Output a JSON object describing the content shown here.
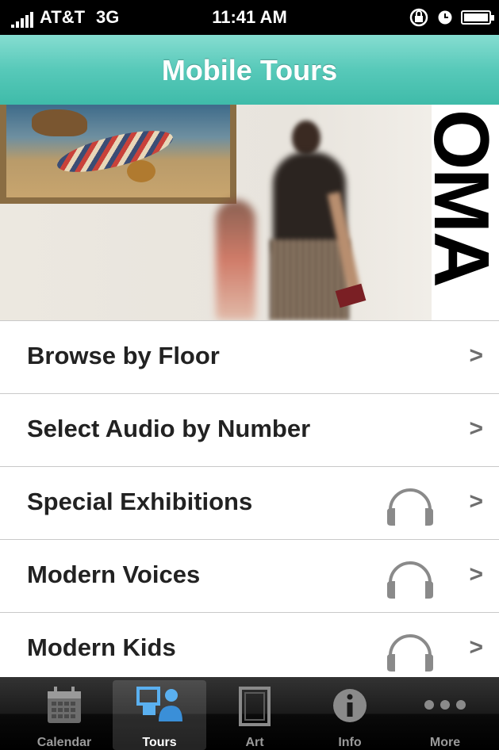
{
  "status_bar": {
    "carrier": "AT&T",
    "network": "3G",
    "time": "11:41 AM"
  },
  "nav": {
    "title": "Mobile Tours"
  },
  "hero": {
    "wall_text": "OMA"
  },
  "menu": [
    {
      "label": "Browse by Floor",
      "audio": false
    },
    {
      "label": "Select Audio by Number",
      "audio": false
    },
    {
      "label": "Special Exhibitions",
      "audio": true
    },
    {
      "label": "Modern Voices",
      "audio": true
    },
    {
      "label": "Modern Kids",
      "audio": true
    }
  ],
  "tabs": [
    {
      "label": "Calendar",
      "icon": "calendar-icon",
      "active": false
    },
    {
      "label": "Tours",
      "icon": "tours-icon",
      "active": true
    },
    {
      "label": "Art",
      "icon": "frame-icon",
      "active": false
    },
    {
      "label": "Info",
      "icon": "info-icon",
      "active": false
    },
    {
      "label": "More",
      "icon": "more-icon",
      "active": false
    }
  ],
  "colors": {
    "nav_bar": "#57c9b9",
    "tab_active": "#3a8fd8"
  }
}
